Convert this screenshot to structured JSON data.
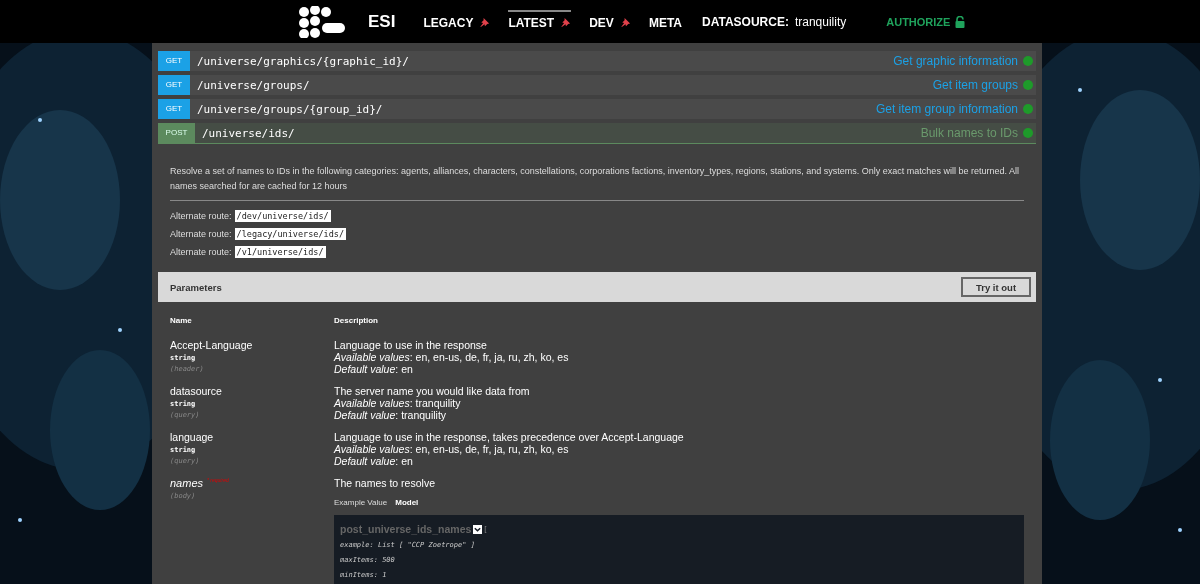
{
  "header": {
    "brand": "ESI",
    "nav": [
      {
        "label": "LEGACY",
        "pinned": true,
        "selected": false
      },
      {
        "label": "LATEST",
        "pinned": true,
        "selected": true
      },
      {
        "label": "DEV",
        "pinned": true,
        "selected": false
      },
      {
        "label": "META",
        "pinned": false,
        "selected": false
      }
    ],
    "datasource_label": "DATASOURCE:",
    "datasource_value": "tranquility",
    "authorize": "AUTHORIZE"
  },
  "endpoints": [
    {
      "method": "GET",
      "path": "/universe/graphics/{graphic_id}/",
      "summary": "Get graphic information",
      "expanded": false
    },
    {
      "method": "GET",
      "path": "/universe/groups/",
      "summary": "Get item groups",
      "expanded": false
    },
    {
      "method": "GET",
      "path": "/universe/groups/{group_id}/",
      "summary": "Get item group information",
      "expanded": false
    },
    {
      "method": "POST",
      "path": "/universe/ids/",
      "summary": "Bulk names to IDs",
      "expanded": true
    }
  ],
  "detail": {
    "description": "Resolve a set of names to IDs in the following categories: agents, alliances, characters, constellations, corporations factions, inventory_types, regions, stations, and systems. Only exact matches will be returned. All names searched for are cached for 12 hours",
    "routes": [
      {
        "label": "Alternate route:",
        "path": "/dev/universe/ids/"
      },
      {
        "label": "Alternate route:",
        "path": "/legacy/universe/ids/"
      },
      {
        "label": "Alternate route:",
        "path": "/v1/universe/ids/"
      }
    ],
    "parameters_title": "Parameters",
    "try_button": "Try it out",
    "columns": [
      "Name",
      "Description"
    ],
    "params": [
      {
        "name": "Accept-Language",
        "type": "string",
        "location": "(header)",
        "required": false,
        "description": "Language to use in the response",
        "lines": [
          {
            "label": "Available values",
            "value": ": en, en-us, de, fr, ja, ru, zh, ko, es"
          },
          {
            "label": "Default value",
            "value": ": en"
          }
        ]
      },
      {
        "name": "datasource",
        "type": "string",
        "location": "(query)",
        "required": false,
        "description": "The server name you would like data from",
        "lines": [
          {
            "label": "Available values",
            "value": ": tranquility"
          },
          {
            "label": "Default value",
            "value": ": tranquility"
          }
        ]
      },
      {
        "name": "language",
        "type": "string",
        "location": "(query)",
        "required": false,
        "description": "Language to use in the response, takes precedence over Accept-Language",
        "lines": [
          {
            "label": "Available values",
            "value": ": en, en-us, de, fr, ja, ru, zh, ko, es"
          },
          {
            "label": "Default value",
            "value": ": en"
          }
        ]
      },
      {
        "name": "names",
        "required_label": "* required",
        "location": "(body)",
        "required": true,
        "description": "The names to resolve"
      }
    ],
    "schema_tabs": [
      {
        "label": "Example Value",
        "selected": false
      },
      {
        "label": "Model",
        "selected": true
      }
    ],
    "model": {
      "name": "post_universe_ids_names",
      "bracket": "[",
      "lines": [
        "example: List [ \"CCP Zoetrope\" ]",
        "maxItems: 500",
        "minItems: 1"
      ]
    }
  }
}
